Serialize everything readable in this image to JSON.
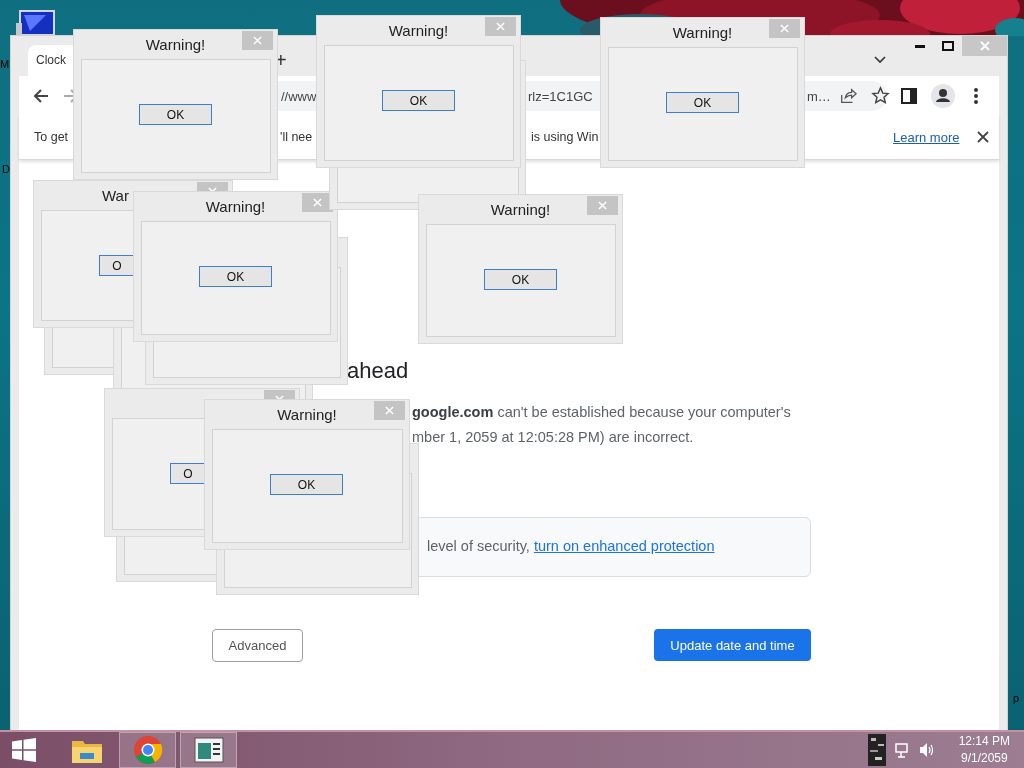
{
  "desktop": {
    "icon_labels": [
      "M",
      "D",
      "p"
    ]
  },
  "browser": {
    "tab": {
      "title": "Clock"
    },
    "new_tab": "+",
    "address_fragments": [
      "//www",
      "rlz=1C1GC",
      "m…"
    ],
    "infobar": {
      "fragments": [
        "To get",
        "'ll nee",
        "is using Win"
      ],
      "link": "Learn more"
    },
    "page": {
      "heading": "ahead",
      "lines": [
        "**google.com** can't be established because your computer's",
        "mber 1, 2059 at 12:05:28 PM) are incorrect."
      ],
      "protection": {
        "text": "level of security, ",
        "link": "turn on enhanced protection"
      },
      "buttons": [
        {
          "label": "Advanced",
          "kind": "secondary"
        },
        {
          "label": "Update date and time",
          "kind": "primary"
        }
      ]
    }
  },
  "dialogs": [
    {
      "kind": "frame"
    },
    {
      "kind": "frame"
    },
    {
      "kind": "partial",
      "title": "War",
      "button": "O"
    },
    {
      "kind": "frame"
    },
    {
      "kind": "full",
      "title": "Warning!",
      "button": "OK"
    },
    {
      "kind": "frame"
    },
    {
      "kind": "full",
      "title": "Warning!",
      "button": "OK"
    },
    {
      "kind": "full",
      "title": "Warning!",
      "button": "OK"
    },
    {
      "kind": "full",
      "title": "Warning!",
      "button": "OK"
    },
    {
      "kind": "full",
      "title": "Warning!",
      "button": "OK"
    },
    {
      "kind": "frame"
    },
    {
      "kind": "partial",
      "button": "O"
    },
    {
      "kind": "frame"
    },
    {
      "kind": "full",
      "title": "Warning!",
      "button": "OK"
    }
  ],
  "taskbar": {
    "apps": [
      {
        "kind": "folder",
        "open": false
      },
      {
        "kind": "browser",
        "open": true
      },
      {
        "kind": "document",
        "open": true
      }
    ],
    "clock": {
      "time": "12:14 PM",
      "date": "9/1/2059"
    }
  }
}
